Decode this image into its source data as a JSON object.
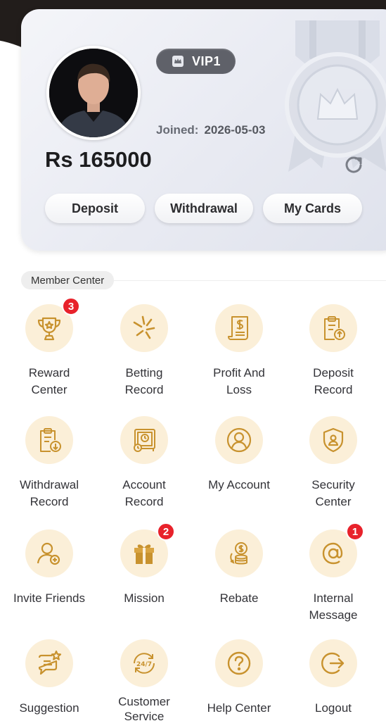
{
  "profile": {
    "vip_level": "VIP1",
    "joined_label": "Joined:",
    "joined_date": "2026-05-03",
    "balance": "Rs 165000"
  },
  "actions": {
    "deposit": "Deposit",
    "withdrawal": "Withdrawal",
    "my_cards": "My Cards"
  },
  "member_center": {
    "title": "Member Center",
    "items": [
      {
        "label_1": "Reward",
        "label_2": "Center",
        "icon": "trophy-icon",
        "badge": "3"
      },
      {
        "label_1": "Betting",
        "label_2": "Record",
        "icon": "sparkle-icon"
      },
      {
        "label_1": "Profit And",
        "label_2": "Loss",
        "icon": "receipt-icon"
      },
      {
        "label_1": "Deposit",
        "label_2": "Record",
        "icon": "clipboard-upload-icon"
      },
      {
        "label_1": "Withdrawal",
        "label_2": "Record",
        "icon": "clipboard-download-icon"
      },
      {
        "label_1": "Account",
        "label_2": "Record",
        "icon": "safe-icon"
      },
      {
        "label_1": "My Account",
        "label_2": "",
        "icon": "user-icon"
      },
      {
        "label_1": "Security",
        "label_2": "Center",
        "icon": "shield-icon"
      },
      {
        "label_1": "Invite Friends",
        "label_2": "",
        "icon": "add-user-icon"
      },
      {
        "label_1": "Mission",
        "label_2": "",
        "icon": "gift-icon",
        "badge": "2"
      },
      {
        "label_1": "Rebate",
        "label_2": "",
        "icon": "coins-icon"
      },
      {
        "label_1": "Internal",
        "label_2": "Message",
        "icon": "at-icon",
        "badge": "1"
      },
      {
        "label_1": "Suggestion",
        "label_2": "",
        "icon": "chat-icon"
      },
      {
        "label_1": "Customer",
        "label_2": "Service",
        "icon": "support-24-7-icon"
      },
      {
        "label_1": "Help Center",
        "label_2": "",
        "icon": "question-icon"
      },
      {
        "label_1": "Logout",
        "label_2": "",
        "icon": "logout-icon"
      }
    ]
  },
  "colors": {
    "icon_bg": "#fbefd8",
    "icon_stroke": "#c8922e",
    "badge": "#e8222b"
  }
}
